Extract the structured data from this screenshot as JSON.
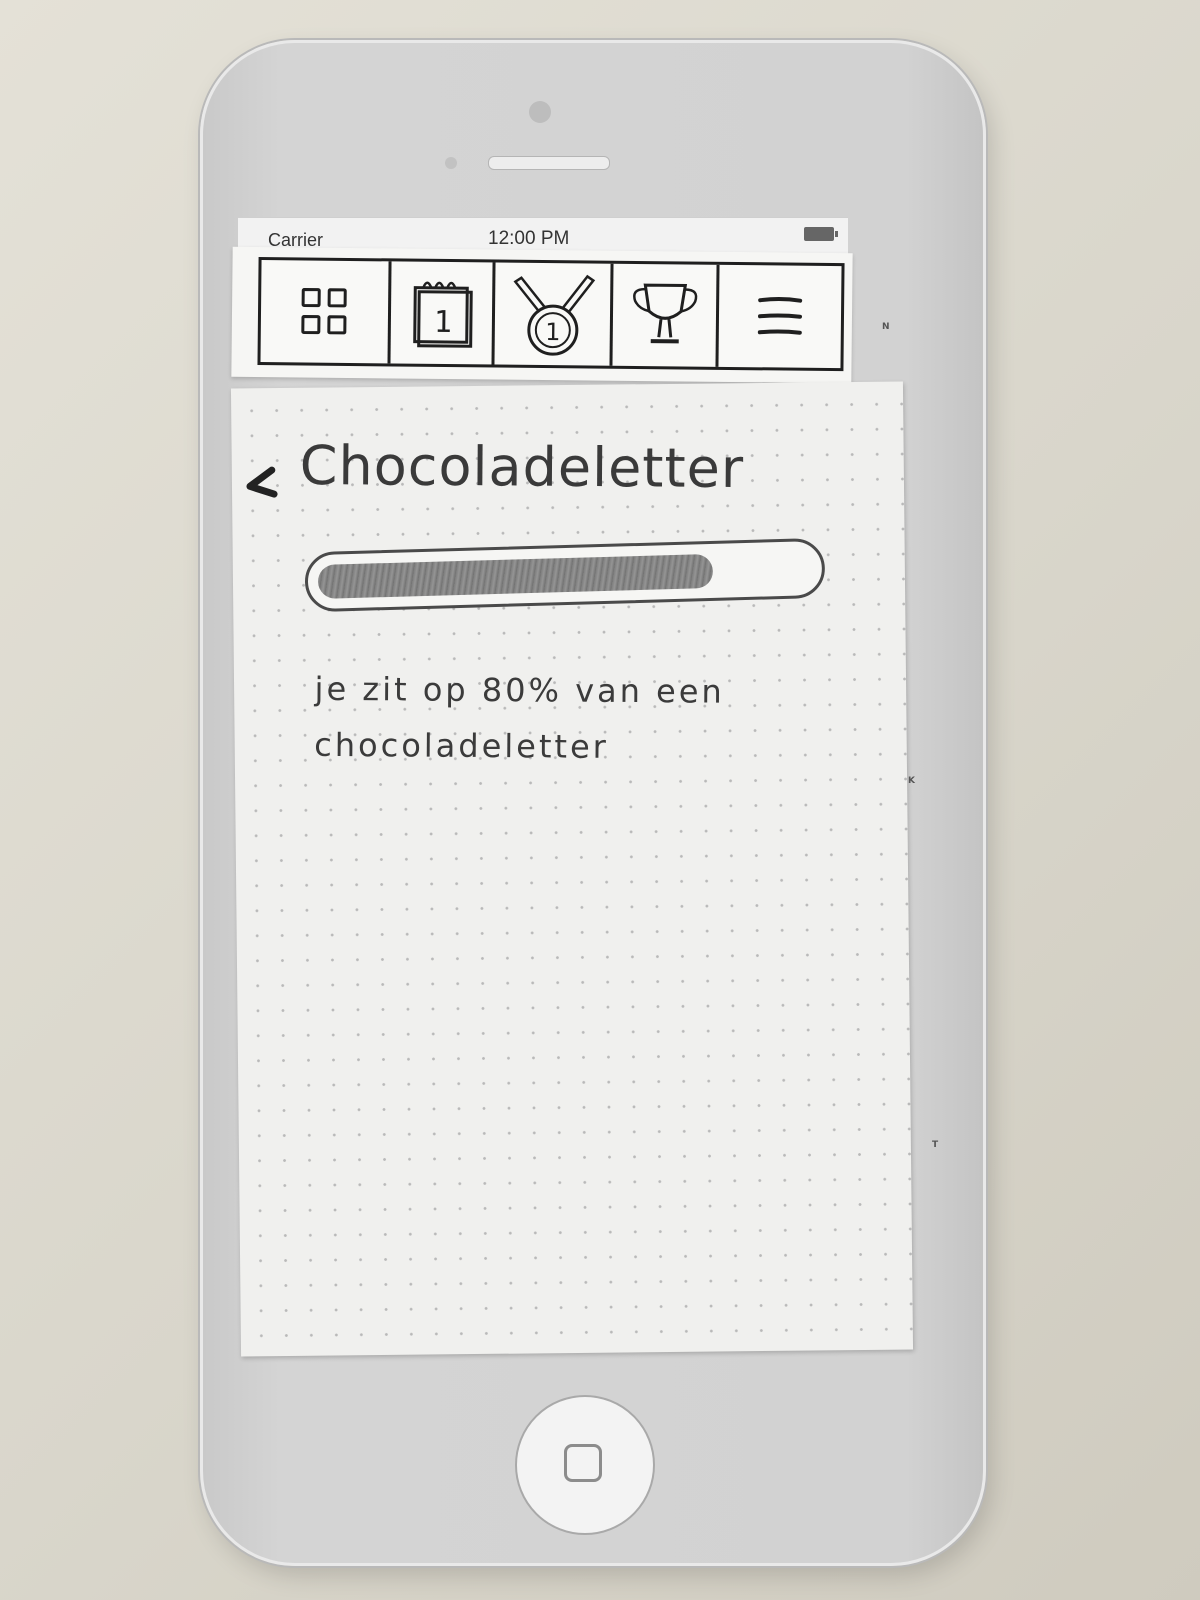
{
  "status_bar": {
    "carrier": "Carrier",
    "time": "12:00 PM"
  },
  "nav": {
    "items": [
      {
        "name": "grid",
        "icon": "grid-icon"
      },
      {
        "name": "calendar",
        "icon": "calendar-icon",
        "label": "1"
      },
      {
        "name": "medal",
        "icon": "medal-icon",
        "label": "1"
      },
      {
        "name": "trophy",
        "icon": "trophy-icon"
      },
      {
        "name": "menu",
        "icon": "hamburger-menu-icon"
      }
    ]
  },
  "page": {
    "title": "Chocoladeletter",
    "progress": 0.8,
    "message": "je zit op 80% van een chocoladeletter"
  }
}
